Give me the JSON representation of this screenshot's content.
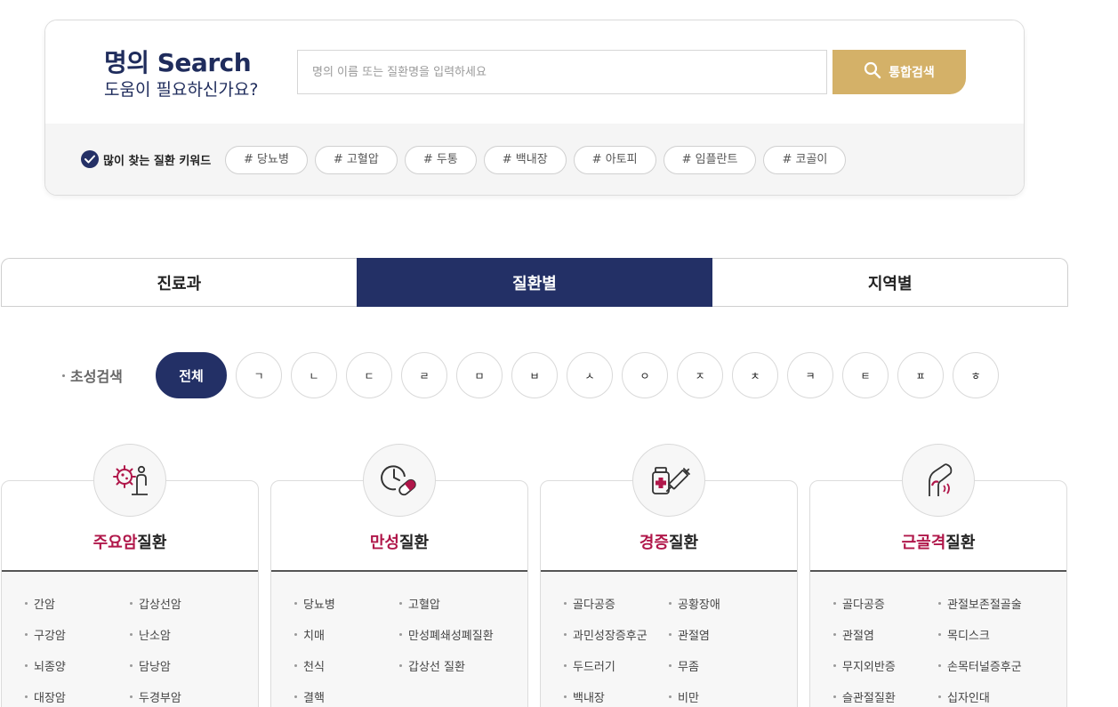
{
  "search": {
    "title": "명의 Search",
    "subtitle": "도움이 필요하신가요?",
    "placeholder": "명의 이름 또는 질환명을 입력하세요",
    "button_label": "통합검색",
    "search_icon": "search-icon"
  },
  "keywords": {
    "label": "많이 찾는 질환 키워드",
    "items": [
      "# 당뇨병",
      "# 고혈압",
      "# 두통",
      "# 백내장",
      "# 아토피",
      "# 임플란트",
      "# 코골이"
    ]
  },
  "tabs": [
    {
      "label": "진료과",
      "active": false
    },
    {
      "label": "질환별",
      "active": true
    },
    {
      "label": "지역별",
      "active": false
    }
  ],
  "initials": {
    "label": "초성검색",
    "items": [
      "전체",
      "ㄱ",
      "ㄴ",
      "ㄷ",
      "ㄹ",
      "ㅁ",
      "ㅂ",
      "ㅅ",
      "ㅇ",
      "ㅈ",
      "ㅊ",
      "ㅋ",
      "ㅌ",
      "ㅍ",
      "ㅎ"
    ]
  },
  "categories": [
    {
      "icon": "cancer-cell-icon",
      "title_highlight": "주요암",
      "title_rest": "질환",
      "items": [
        "간암",
        "갑상선암",
        "구강암",
        "난소암",
        "뇌종양",
        "담낭암",
        "대장암",
        "두경부암"
      ]
    },
    {
      "icon": "clock-pill-icon",
      "title_highlight": "만성",
      "title_rest": "질환",
      "items": [
        "당뇨병",
        "고혈압",
        "치매",
        "만성폐쇄성폐질환",
        "천식",
        "갑상선 질환",
        "결핵"
      ]
    },
    {
      "icon": "medicine-syringe-icon",
      "title_highlight": "경증",
      "title_rest": "질환",
      "items": [
        "골다공증",
        "공황장애",
        "과민성장증후군",
        "관절염",
        "두드러기",
        "무좀",
        "백내장",
        "비만"
      ]
    },
    {
      "icon": "joint-icon",
      "title_highlight": "근골격",
      "title_rest": "질환",
      "items": [
        "골다공증",
        "관절보존절골술",
        "관절염",
        "목디스크",
        "무지외반증",
        "손목터널증후군",
        "슬관절질환",
        "십자인대"
      ]
    }
  ],
  "colors": {
    "navy": "#233066",
    "gold": "#d4b168",
    "accent_red": "#b0174a"
  }
}
